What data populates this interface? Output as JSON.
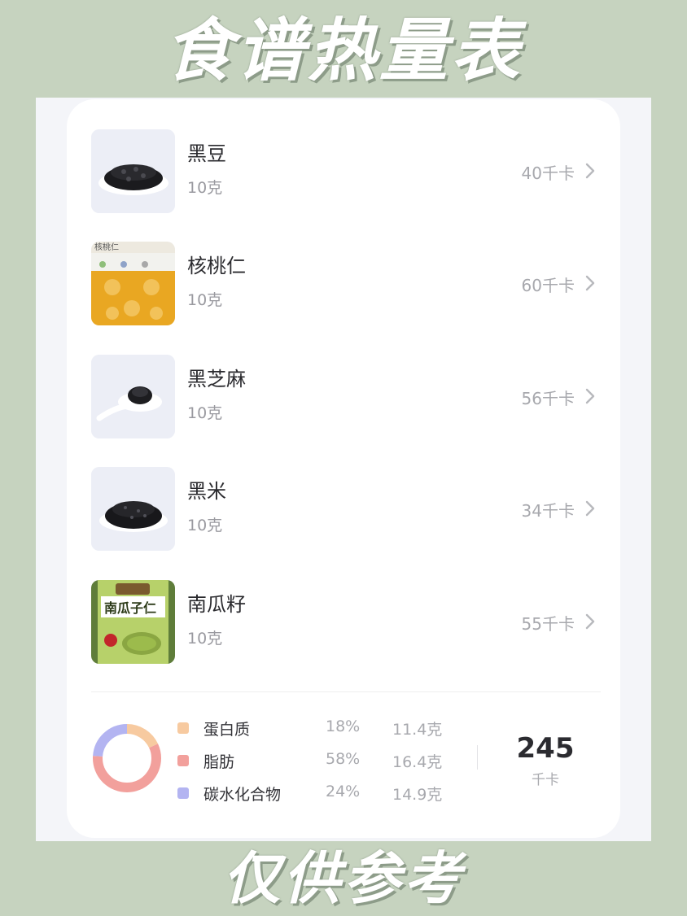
{
  "header": {
    "title": "食谱热量表"
  },
  "footer": {
    "caption": "仅供参考"
  },
  "foods": [
    {
      "name": "黑豆",
      "amount": "10克",
      "kcal": "40千卡",
      "icon": "black-beans-photo"
    },
    {
      "name": "核桃仁",
      "amount": "10克",
      "kcal": "60千卡",
      "icon": "walnut-package-photo",
      "image_text": "核桃仁"
    },
    {
      "name": "黑芝麻",
      "amount": "10克",
      "kcal": "56千卡",
      "icon": "black-sesame-spoon-photo"
    },
    {
      "name": "黑米",
      "amount": "10克",
      "kcal": "34千卡",
      "icon": "black-rice-photo"
    },
    {
      "name": "南瓜籽",
      "amount": "10克",
      "kcal": "55千卡",
      "icon": "pumpkin-seed-jar-photo",
      "image_text": "南瓜子仁"
    }
  ],
  "summary": {
    "macros": [
      {
        "name": "蛋白质",
        "percent": "18%",
        "grams": "11.4克",
        "color": "#f7caa0"
      },
      {
        "name": "脂肪",
        "percent": "58%",
        "grams": "16.4克",
        "color": "#f2a09c"
      },
      {
        "name": "碳水化合物",
        "percent": "24%",
        "grams": "14.9克",
        "color": "#b3b4f1"
      }
    ],
    "donut_fractions": [
      0.18,
      0.58,
      0.24
    ],
    "total_value": "245",
    "total_unit": "千卡"
  },
  "colors": {
    "background": "#c6d3bf",
    "card": "#ffffff",
    "title_shadow": "#8d9c89"
  }
}
